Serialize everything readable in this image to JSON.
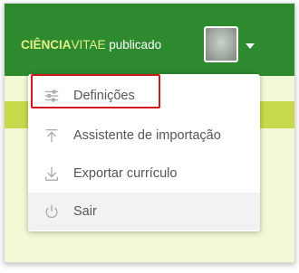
{
  "header": {
    "brand_part1": "CIÊNCIA",
    "brand_part2": "VITAE",
    "brand_part3": " publicado"
  },
  "menu": {
    "items": [
      {
        "label": "Definições",
        "icon": "sliders-icon"
      },
      {
        "label": "Assistente de importação",
        "icon": "upload-icon"
      },
      {
        "label": "Exportar currículo",
        "icon": "download-icon"
      },
      {
        "label": "Sair",
        "icon": "power-icon"
      }
    ]
  },
  "colors": {
    "topbar": "#2e8a2e",
    "accent_lime": "#c7d94a",
    "highlight": "#d0161f"
  }
}
